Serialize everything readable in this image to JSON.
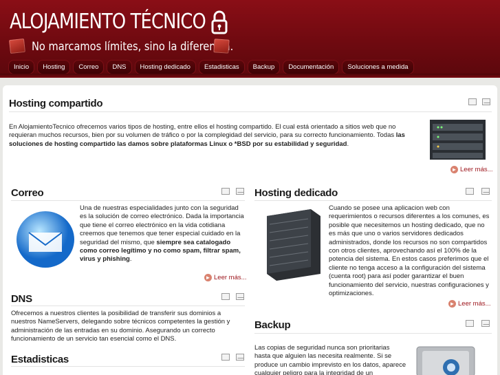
{
  "header": {
    "title": "ALOJAMIENTO TÉCNICO",
    "tagline": "No marcamos límites, sino la diferencia."
  },
  "nav": [
    "Inicio",
    "Hosting",
    "Correo",
    "DNS",
    "Hosting dedicado",
    "Estadisticas",
    "Backup",
    "Documentación",
    "Soluciones a medida"
  ],
  "sections": {
    "shared": {
      "title": "Hosting compartido",
      "text": "En AlojamientoTecnico ofrecemos varios tipos de hosting, entre ellos el hosting compartido. El cual está orientado a sitios web que no requieran muchos recursos, bien por su volumen de tráfico o por la complegidad del servicio, para su correcto funcionamiento. Todas ",
      "bold": "las soluciones de hosting compartido las damos sobre plataformas Linux o *BSD por su estabilidad y seguridad",
      "end": ".",
      "more": "Leer más..."
    },
    "mail": {
      "title": "Correo",
      "text": "Una de nuestras especialidades junto con la seguridad es la solución de correo electrónico. Dada la importancia que tiene el correo electrónico en la vida cotidiana creemos que tenemos que tener especial cuidado en la seguridad del mismo, que ",
      "bold": "siempre sea catalogado como correo legítimo y no como spam, filtrar spam, virus y phishing",
      "end": ".",
      "more": "Leer más..."
    },
    "dedicated": {
      "title": "Hosting dedicado",
      "text": "Cuando se posee una aplicacion web con requerimientos o recursos diferentes a los comunes, es posible que necesitemos un hosting dedicado, que no es más que uno o varios servidores dedicados administrados, donde los recursos no son compartidos con otros clientes, aprovechando así el 100% de la potencia del sistema. En estos casos preferimos que el cliente no tenga acceso a la configuración del sistema (cuenta root) para así poder garantizar el buen funcionamiento del servicio, nuestras configuraciones y optimizaciones.",
      "more": "Leer más..."
    },
    "dns": {
      "title": "DNS",
      "text": "Ofrecemos a nuestros clientes la posibilidad de transferir sus dominios a nuestros NameServers, delegando sobre técnicos competentes la gestión y administración de las entradas en su dominio. Asegurando un correcto funcionamiento de un servicio tan esencial como el DNS."
    },
    "backup": {
      "title": "Backup",
      "text": "Las copias de seguridad nunca son prioritarias hasta que alguien las necesita realmente. Si se produce un cambio imprevisto en los datos, aparece cualquier peligro para la integridad de un"
    },
    "stats": {
      "title": "Estadisticas"
    }
  }
}
